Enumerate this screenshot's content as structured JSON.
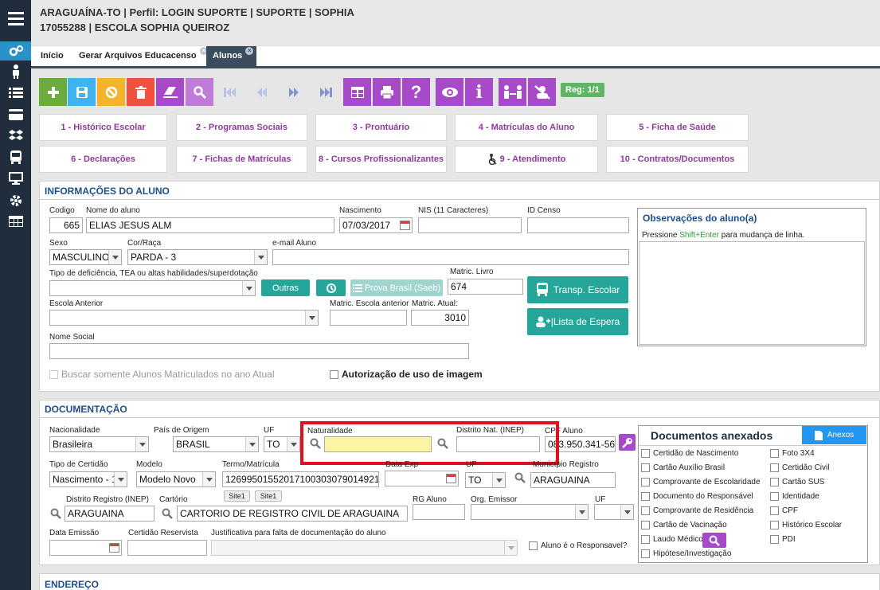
{
  "header": {
    "line1": "ARAGUAÍNA-TO | Perfil: LOGIN SUPORTE | SUPORTE | SOPHIA",
    "line2": "17055288 | ESCOLA SOPHIA QUEIROZ"
  },
  "tabs": [
    {
      "label": "Início"
    },
    {
      "label": "Gerar Arquivos Educacenso"
    },
    {
      "label": "Alunos"
    }
  ],
  "toolbar": {
    "reg": "Reg: 1/1"
  },
  "shortcuts": [
    "1 - Histórico Escolar",
    "2 - Programas Sociais",
    "3 - Prontuário",
    "4 - Matrículas do Aluno",
    "5 - Ficha de Saúde",
    "6 - Declarações",
    "7 - Fichas de Matrículas",
    "8 - Cursos Profissionalizantes",
    "9 - Atendimento",
    "10 - Contratos/Documentos"
  ],
  "info": {
    "title": "INFORMAÇÕES DO ALUNO",
    "codigo_label": "Codigo",
    "codigo": "665",
    "nome_label": "Nome do aluno",
    "nome": "ELIAS JESUS ALM",
    "nasc_label": "Nascimento",
    "nasc": "07/03/2017",
    "nis_label": "NIS (11 Caracteres)",
    "nis": "",
    "idcenso_label": "ID Censo",
    "idcenso": "",
    "sexo_label": "Sexo",
    "sexo": "MASCULINO",
    "cor_label": "Cor/Raça",
    "cor": "PARDA  - 3",
    "email_label": "e-mail Aluno",
    "email": "",
    "def_label": "Tipo de deficiência, TEA ou altas habilidades/superdotação",
    "outras": "Outras",
    "prova": "Prova Brasil (Saeb)",
    "livro_label": "Matric. Livro",
    "livro": "674",
    "transp": "Transp. Escolar",
    "escola_label": "Escola Anterior",
    "matesc_label": "Matric. Escola anterior",
    "matatual_label": "Matric. Atual:",
    "matatual": "3010",
    "espera": "|Lista de Espera",
    "nomesocial_label": "Nome Social",
    "buscar": "Buscar somente Alunos Matriculados no ano Atual",
    "autoriz": "Autorização de uso de imagem",
    "obs_title": "Observações do aluno(a)",
    "obs_hint_pre": "Pressione ",
    "obs_hint_key": "Shift+Enter",
    "obs_hint_post": " para mudança de linha."
  },
  "doc": {
    "title": "DOCUMENTAÇÃO",
    "nac_label": "Nacionalidade",
    "nac": "Brasileira",
    "pais_label": "País de Origem",
    "pais": "BRASIL",
    "uf_label": "UF",
    "uf": "TO",
    "natur_label": "Naturalidade",
    "natur": "",
    "distrito_label": "Distrito Nat. (INEP)",
    "distrito": "",
    "cpf_label": "CPF Aluno",
    "cpf": "083.950.341-56",
    "tipocert_label": "Tipo de Certidão",
    "tipocert": "Nascimento - 1",
    "modelo_label": "Modelo",
    "modelo": "Modelo Novo",
    "termo_label": "Termo/Matrícula",
    "termo": "126995015520171003030790149212",
    "dataexp_label": "Data Exp",
    "uf2_label": "UF",
    "uf2": "TO",
    "mun_label": "Município Registro",
    "mun": "ARAGUAINA",
    "site1": "Site1",
    "site2": "Site1",
    "distreg_label": "Distrito Registro (INEP)",
    "distreg": "ARAGUAINA",
    "cart_label": "Cartório",
    "cart": "CARTORIO DE REGISTRO CIVIL DE ARAGUAINA",
    "rg_label": "RG Aluno",
    "org_label": "Org. Emissor",
    "uf3_label": "UF",
    "dataemi_label": "Data Emissão",
    "reserv_label": "Certidão Reservista",
    "just_label": "Justificativa para falta de documentação do aluno",
    "resp": "Aluno é o Responsavel?"
  },
  "anexos": {
    "title": "Documentos anexados",
    "btn": "Anexos",
    "left": [
      "Certidão de Nascimento",
      "Cartão Auxílio Brasil",
      "Comprovante de Escolaridade",
      "Documento do Responsável",
      "Comprovante de Residência",
      "Cartão de Vacinação",
      "Laudo Médico",
      "Hipótese/Investigação"
    ],
    "right": [
      "Foto 3X4",
      "Certidão Civil",
      "Cartão SUS",
      "Identidade",
      "CPF",
      "Histórico Escolar",
      "PDI"
    ]
  },
  "endereco": {
    "title": "ENDEREÇO"
  },
  "colors": {
    "sidebar": "#1f2d3d",
    "active": "#2b91c9",
    "purple": "#a64ac9",
    "teal": "#26a69a",
    "red": "#e01020"
  }
}
